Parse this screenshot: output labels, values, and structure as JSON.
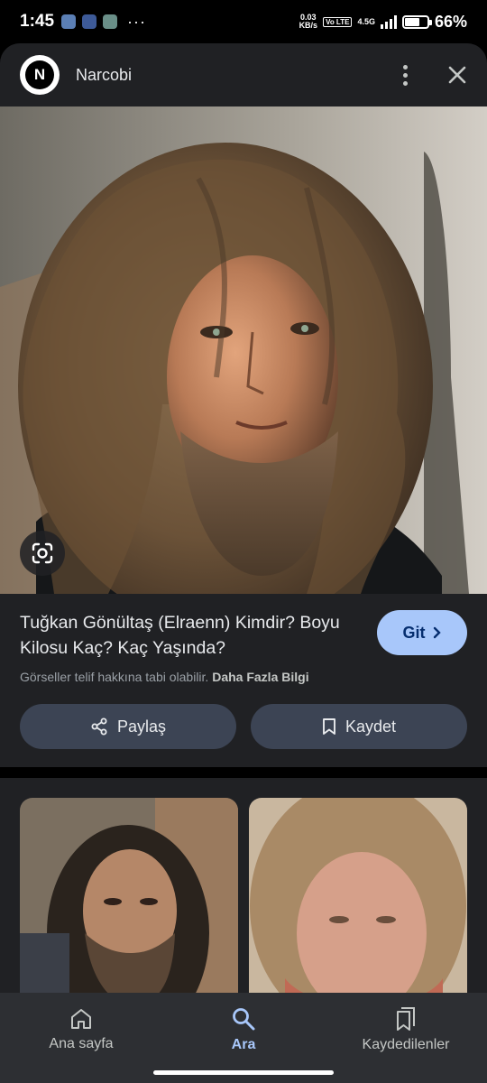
{
  "status_bar": {
    "time": "1:45",
    "dots": "···",
    "net_speed_value": "0.03",
    "net_speed_unit": "KB/s",
    "volte": "Vo LTE",
    "network": "4.5G",
    "battery_percent": "66%",
    "battery_level": 0.66
  },
  "header": {
    "logo_letter": "N",
    "site_name": "Narcobi"
  },
  "result": {
    "title": "Tuğkan Gönültaş (Elraenn) Kimdir? Boyu Kilosu Kaç? Kaç Yaşında?",
    "go_label": "Git",
    "copyright_text": "Görseller telif hakkına tabi olabilir.",
    "more_info_label": "Daha Fazla Bilgi"
  },
  "actions": {
    "share_label": "Paylaş",
    "save_label": "Kaydet"
  },
  "bottom_nav": {
    "items": [
      {
        "label": "Ana sayfa",
        "icon": "home-icon"
      },
      {
        "label": "Ara",
        "icon": "search-icon"
      },
      {
        "label": "Kaydedilenler",
        "icon": "bookmarks-icon"
      }
    ],
    "active_index": 1
  },
  "colors": {
    "accent": "#a8c7fa",
    "sheet_bg": "#202124",
    "button_bg": "#3c4454"
  }
}
